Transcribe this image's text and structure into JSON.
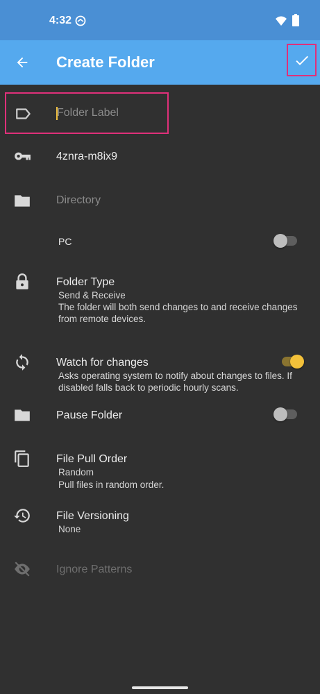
{
  "status_bar": {
    "time": "4:32",
    "sync_icon": "sync-status-icon",
    "wifi_icon": "wifi-icon",
    "battery_icon": "battery-icon"
  },
  "app_bar": {
    "title": "Create Folder",
    "back_icon": "arrow-back-icon",
    "confirm_icon": "check-icon"
  },
  "colors": {
    "status_bar": "#4a8fd4",
    "app_bar": "#55a9ee",
    "background": "#303030",
    "accent": "#f3c13a",
    "highlight_border": "#e0307a"
  },
  "form": {
    "folder_label": {
      "placeholder": "Folder Label",
      "value": "",
      "icon": "label-icon"
    },
    "folder_id": {
      "value": "4znra-m8ix9",
      "icon": "key-icon"
    },
    "directory": {
      "placeholder": "Directory",
      "icon": "folder-icon"
    },
    "device_pc": {
      "label": "PC",
      "enabled": false
    },
    "folder_type": {
      "title": "Folder Type",
      "value": "Send & Receive",
      "description": "The folder will both send changes to and receive changes from remote devices.",
      "icon": "lock-icon"
    },
    "watch_changes": {
      "title": "Watch for changes",
      "description": "Asks operating system to notify about changes to files. If disabled falls back to periodic hourly scans.",
      "enabled": true,
      "icon": "sync-icon"
    },
    "pause_folder": {
      "title": "Pause Folder",
      "enabled": false,
      "icon": "folder-icon"
    },
    "file_pull_order": {
      "title": "File Pull Order",
      "value": "Random",
      "description": "Pull files in random order.",
      "icon": "copy-icon"
    },
    "file_versioning": {
      "title": "File Versioning",
      "value": "None",
      "icon": "history-icon"
    },
    "ignore_patterns": {
      "title": "Ignore Patterns",
      "icon": "eye-off-icon"
    }
  }
}
